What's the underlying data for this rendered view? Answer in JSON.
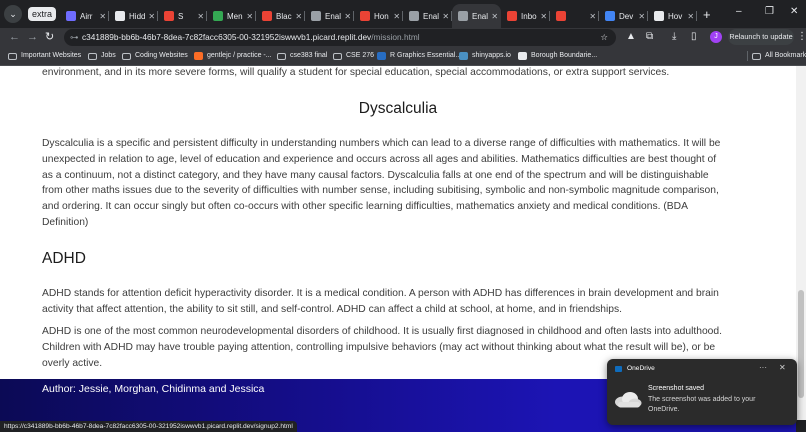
{
  "browser": {
    "tab_group_label": "extra",
    "tabs": [
      {
        "title": "Airr",
        "favicon_color": "#6f6cff"
      },
      {
        "title": "Hidd",
        "favicon_color": "#e8eaed"
      },
      {
        "title": "S",
        "favicon_color": "#ea4335"
      },
      {
        "title": "Men",
        "favicon_color": "#34a853"
      },
      {
        "title": "Blac",
        "favicon_color": "#ea4335"
      },
      {
        "title": "Enal",
        "favicon_color": "#9aa0a6"
      },
      {
        "title": "Hon",
        "favicon_color": "#ea4335"
      },
      {
        "title": "Enal",
        "favicon_color": "#9aa0a6"
      },
      {
        "title": "Enal",
        "favicon_color": "#9aa0a6",
        "active": true
      },
      {
        "title": "Inbo",
        "favicon_color": "#ea4335"
      },
      {
        "title": "",
        "favicon_color": "#ea4335"
      },
      {
        "title": "Dev",
        "favicon_color": "#4285f4"
      },
      {
        "title": "Hov",
        "favicon_color": "#e8eaed"
      }
    ],
    "url_host": "c341889b-bb6b-46b7-8dea-7c82facc6305-00-321952iswwvb1.picard.replit.dev",
    "url_path": "/mission.html",
    "avatar_letter": "J",
    "relaunch_label": "Relaunch to update",
    "bookmarks": [
      {
        "label": "Important Websites",
        "icon": "folder-icon"
      },
      {
        "label": "Jobs",
        "icon": "folder-icon"
      },
      {
        "label": "Coding Websites",
        "icon": "folder-icon"
      },
      {
        "label": "gentlejc / practice -...",
        "icon": "gitlab-icon"
      },
      {
        "label": "cse383 final",
        "icon": "folder-icon"
      },
      {
        "label": "CSE 276",
        "icon": "folder-icon"
      },
      {
        "label": "R Graphics Essential...",
        "icon": "r-icon"
      },
      {
        "label": "shinyapps.io",
        "icon": "shiny-icon"
      },
      {
        "label": "Borough Boundarie...",
        "icon": "page-icon"
      }
    ],
    "all_bookmarks_label": "All Bookmarks",
    "status_url": "https://c341889b-bb6b-46b7-8dea-7c82facc6305-00-321952iswwvb1.picard.replit.dev/signup2.html"
  },
  "page": {
    "intro_text": "environment, and in its more severe forms, will qualify a student for special education, special accommodations, or extra support services.",
    "dyscalculia_heading": "Dyscalculia",
    "dyscalculia_text": "Dyscalculia is a specific and persistent difficulty in understanding numbers which can lead to a diverse range of difficulties with mathematics. It will be unexpected in relation to age, level of education and experience and occurs across all ages and abilities. Mathematics difficulties are best thought of as a continuum, not a distinct category, and they have many causal factors. Dyscalculia falls at one end of the spectrum and will be distinguishable from other maths issues due to the severity of difficulties with number sense, including subitising, symbolic and non-symbolic magnitude comparison, and ordering. It can occur singly but often co-occurs with other specific learning difficulties, mathematics anxiety and medical conditions. (BDA Definition)",
    "adhd_heading": "ADHD",
    "adhd_text_1": "ADHD stands for attention deficit hyperactivity disorder. It is a medical condition. A person with ADHD has differences in brain development and brain activity that affect attention, the ability to sit still, and self-control. ADHD can affect a child at school, at home, and in friendships.",
    "adhd_text_2": "ADHD is one of the most common neurodevelopmental disorders of childhood. It is usually first diagnosed in childhood and often lasts into adulthood. Children with ADHD may have trouble paying attention, controlling impulsive behaviors (may act without thinking about what the result will be), or be overly active.",
    "footer_author": "Author: Jessie, Morghan, Chidinma and Jessica"
  },
  "toast": {
    "app_name": "OneDrive",
    "title": "Screenshot saved",
    "body": "The screenshot was added to your OneDrive."
  }
}
